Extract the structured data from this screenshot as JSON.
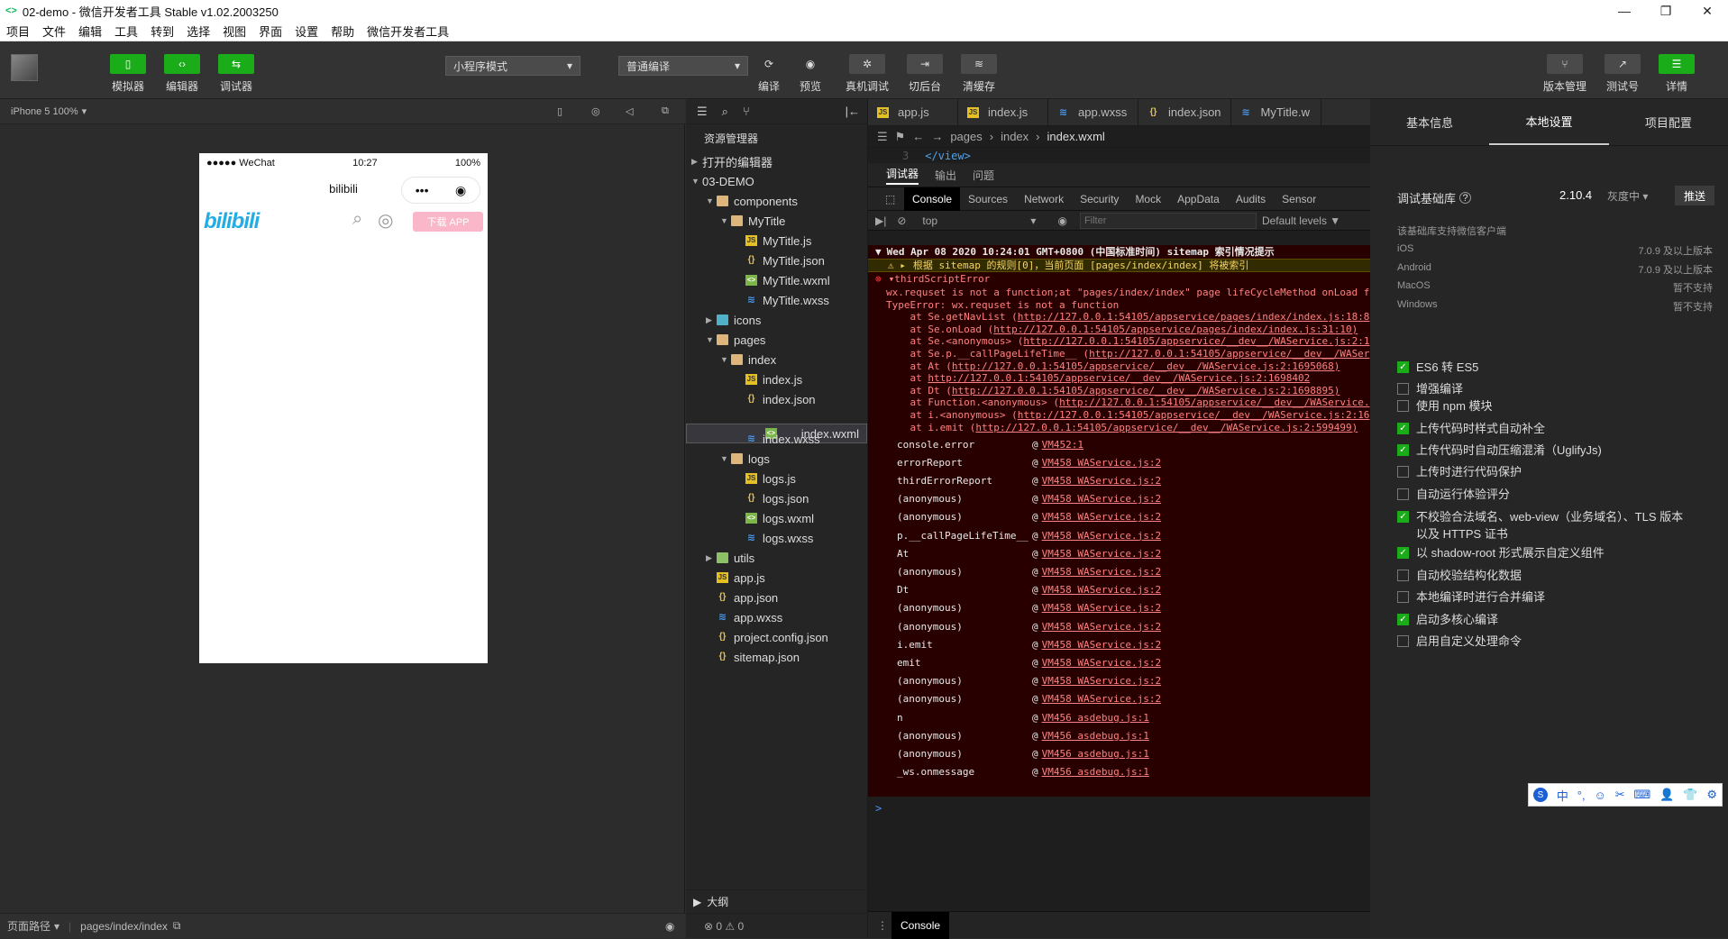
{
  "window": {
    "icon": "<>",
    "title": "02-demo - 微信开发者工具 Stable v1.02.2003250",
    "controls": [
      "—",
      "❐",
      "✕"
    ]
  },
  "menu": [
    "项目",
    "文件",
    "编辑",
    "工具",
    "转到",
    "选择",
    "视图",
    "界面",
    "设置",
    "帮助",
    "微信开发者工具"
  ],
  "toolbar": {
    "simulator": "模拟器",
    "editor": "编辑器",
    "debugger": "调试器",
    "mode": "小程序模式",
    "compile_mode": "普通编译",
    "compile": "编译",
    "preview": "预览",
    "real_debug": "真机调试",
    "background": "切后台",
    "clear_cache": "清缓存",
    "version": "版本管理",
    "test": "测试号",
    "details": "详情"
  },
  "simulator": {
    "device": "iPhone 5 100%",
    "status_left": "●●●●● WeChat",
    "status_time": "10:27",
    "status_battery": "100%",
    "page_title": "bilibili",
    "logo": "bilibili",
    "download": "下载 APP",
    "footer_label": "页面路径",
    "footer_path": "pages/index/index"
  },
  "explorer": {
    "title": "资源管理器",
    "open_editors": "打开的编辑器",
    "project": "03-DEMO",
    "tree": [
      {
        "name": "components",
        "type": "folder",
        "depth": 1,
        "open": true
      },
      {
        "name": "MyTitle",
        "type": "folder",
        "depth": 2,
        "open": true
      },
      {
        "name": "MyTitle.js",
        "type": "js",
        "depth": 3
      },
      {
        "name": "MyTitle.json",
        "type": "json",
        "depth": 3
      },
      {
        "name": "MyTitle.wxml",
        "type": "wxml",
        "depth": 3
      },
      {
        "name": "MyTitle.wxss",
        "type": "wxss",
        "depth": 3
      },
      {
        "name": "icons",
        "type": "folder-teal",
        "depth": 1,
        "open": false
      },
      {
        "name": "pages",
        "type": "folder",
        "depth": 1,
        "open": true
      },
      {
        "name": "index",
        "type": "folder",
        "depth": 2,
        "open": true
      },
      {
        "name": "index.js",
        "type": "js",
        "depth": 3
      },
      {
        "name": "index.json",
        "type": "json",
        "depth": 3
      },
      {
        "name": "index.wxml",
        "type": "wxml",
        "depth": 3,
        "selected": true
      },
      {
        "name": "index.wxss",
        "type": "wxss",
        "depth": 3
      },
      {
        "name": "logs",
        "type": "folder",
        "depth": 2,
        "open": true
      },
      {
        "name": "logs.js",
        "type": "js",
        "depth": 3
      },
      {
        "name": "logs.json",
        "type": "json",
        "depth": 3
      },
      {
        "name": "logs.wxml",
        "type": "wxml",
        "depth": 3
      },
      {
        "name": "logs.wxss",
        "type": "wxss",
        "depth": 3
      },
      {
        "name": "utils",
        "type": "folder-green",
        "depth": 1,
        "open": false
      },
      {
        "name": "app.js",
        "type": "js",
        "depth": 1
      },
      {
        "name": "app.json",
        "type": "json",
        "depth": 1
      },
      {
        "name": "app.wxss",
        "type": "wxss",
        "depth": 1
      },
      {
        "name": "project.config.json",
        "type": "json",
        "depth": 1
      },
      {
        "name": "sitemap.json",
        "type": "json",
        "depth": 1
      }
    ],
    "outline": "大纲",
    "problems": "⊗ 0 ⚠ 0"
  },
  "editor": {
    "tabs": [
      {
        "name": "app.js",
        "type": "js"
      },
      {
        "name": "index.js",
        "type": "js"
      },
      {
        "name": "app.wxss",
        "type": "wxss"
      },
      {
        "name": "index.json",
        "type": "json"
      },
      {
        "name": "MyTitle.w",
        "type": "wxss"
      }
    ],
    "breadcrumb": [
      "pages",
      "index",
      "index.wxml"
    ],
    "line_no": "3",
    "code": "</view>"
  },
  "debugger": {
    "tabs": [
      "调试器",
      "输出",
      "问题"
    ],
    "devtabs": [
      "Console",
      "Sources",
      "Network",
      "Security",
      "Mock",
      "AppData",
      "Audits",
      "Sensor"
    ],
    "context": "top",
    "filter_placeholder": "Filter",
    "levels": "Default levels ▼",
    "date_line": "Wed Apr 08 2020 10:24:01 GMT+0800 (中国标准时间) sitemap 索引情况提示",
    "warning": "根据 sitemap 的规则[0]，当前页面 [pages/index/index] 将被索引",
    "error_title": "thirdScriptError",
    "error_lines": [
      "wx.requset is not a function;at \"pages/index/index\" page lifeCycleMethod onLoad f",
      "TypeError: wx.requset is not a function"
    ],
    "trace": [
      {
        "pre": "    at Se.getNavList (",
        "link": "http://127.0.0.1:54105/appservice/pages/index/index.js:18:8"
      },
      {
        "pre": "    at Se.onLoad (",
        "link": "http://127.0.0.1:54105/appservice/pages/index/index.js:31:10)"
      },
      {
        "pre": "    at Se.<anonymous> (",
        "link": "http://127.0.0.1:54105/appservice/__dev__/WAService.js:2:1"
      },
      {
        "pre": "    at Se.p.__callPageLifeTime__ (",
        "link": "http://127.0.0.1:54105/appservice/__dev__/WASer"
      },
      {
        "pre": "    at At (",
        "link": "http://127.0.0.1:54105/appservice/__dev__/WAService.js:2:1695068)"
      },
      {
        "pre": "    at ",
        "link": "http://127.0.0.1:54105/appservice/__dev__/WAService.js:2:1698402"
      },
      {
        "pre": "    at Dt (",
        "link": "http://127.0.0.1:54105/appservice/__dev__/WAService.js:2:1698895)"
      },
      {
        "pre": "    at Function.<anonymous> (",
        "link": "http://127.0.0.1:54105/appservice/__dev__/WAService."
      },
      {
        "pre": "    at i.<anonymous> (",
        "link": "http://127.0.0.1:54105/appservice/__dev__/WAService.js:2:16"
      },
      {
        "pre": "    at i.emit (",
        "link": "http://127.0.0.1:54105/appservice/__dev__/WAService.js:2:599499)"
      }
    ],
    "stack": [
      {
        "fn": "console.error",
        "src": "VM452:1"
      },
      {
        "fn": "errorReport",
        "src": "VM458 WAService.js:2"
      },
      {
        "fn": "thirdErrorReport",
        "src": "VM458 WAService.js:2"
      },
      {
        "fn": "(anonymous)",
        "src": "VM458 WAService.js:2"
      },
      {
        "fn": "(anonymous)",
        "src": "VM458 WAService.js:2"
      },
      {
        "fn": "p.__callPageLifeTime__",
        "src": "VM458 WAService.js:2"
      },
      {
        "fn": "At",
        "src": "VM458 WAService.js:2"
      },
      {
        "fn": "(anonymous)",
        "src": "VM458 WAService.js:2"
      },
      {
        "fn": "Dt",
        "src": "VM458 WAService.js:2"
      },
      {
        "fn": "(anonymous)",
        "src": "VM458 WAService.js:2"
      },
      {
        "fn": "(anonymous)",
        "src": "VM458 WAService.js:2"
      },
      {
        "fn": "i.emit",
        "src": "VM458 WAService.js:2"
      },
      {
        "fn": "emit",
        "src": "VM458 WAService.js:2"
      },
      {
        "fn": "(anonymous)",
        "src": "VM458 WAService.js:2"
      },
      {
        "fn": "(anonymous)",
        "src": "VM458 WAService.js:2"
      },
      {
        "fn": "n",
        "src": "VM456 asdebug.js:1"
      },
      {
        "fn": "(anonymous)",
        "src": "VM456 asdebug.js:1"
      },
      {
        "fn": "(anonymous)",
        "src": "VM456 asdebug.js:1"
      },
      {
        "fn": "_ws.onmessage",
        "src": "VM456 asdebug.js:1"
      }
    ],
    "prompt": ">",
    "drawer_tab": "Console"
  },
  "right_panel": {
    "tabs": [
      "基本信息",
      "本地设置",
      "项目配置"
    ],
    "lib_label": "调试基础库",
    "lib_version": "2.10.4",
    "lib_gray": "灰度中 ▾",
    "push": "推送",
    "support_title": "该基础库支持微信客户端",
    "platforms": [
      {
        "name": "iOS",
        "value": "7.0.9 及以上版本"
      },
      {
        "name": "Android",
        "value": "7.0.9 及以上版本"
      },
      {
        "name": "MacOS",
        "value": "暂不支持"
      },
      {
        "name": "Windows",
        "value": "暂不支持"
      }
    ],
    "options": [
      {
        "label": "ES6 转 ES5",
        "checked": true
      },
      {
        "label": "增强编译",
        "checked": false
      },
      {
        "label": "使用 npm 模块",
        "checked": false
      },
      {
        "label": "上传代码时样式自动补全",
        "checked": true
      },
      {
        "label": "上传代码时自动压缩混淆（UglifyJs)",
        "checked": true
      },
      {
        "label": "上传时进行代码保护",
        "checked": false
      },
      {
        "label": "自动运行体验评分",
        "checked": false
      },
      {
        "label": "不校验合法域名、web-view（业务域名）、TLS 版本以及 HTTPS 证书",
        "checked": true
      },
      {
        "label": "以 shadow-root 形式展示自定义组件",
        "checked": true
      },
      {
        "label": "自动校验结构化数据",
        "checked": false
      },
      {
        "label": "本地编译时进行合并编译",
        "checked": false
      },
      {
        "label": "启动多核心编译",
        "checked": true
      },
      {
        "label": "启用自定义处理命令",
        "checked": false
      }
    ]
  },
  "ime": [
    "中",
    "°,",
    "☺",
    "✂",
    "⌨",
    "👤",
    "👕",
    "⚙"
  ]
}
